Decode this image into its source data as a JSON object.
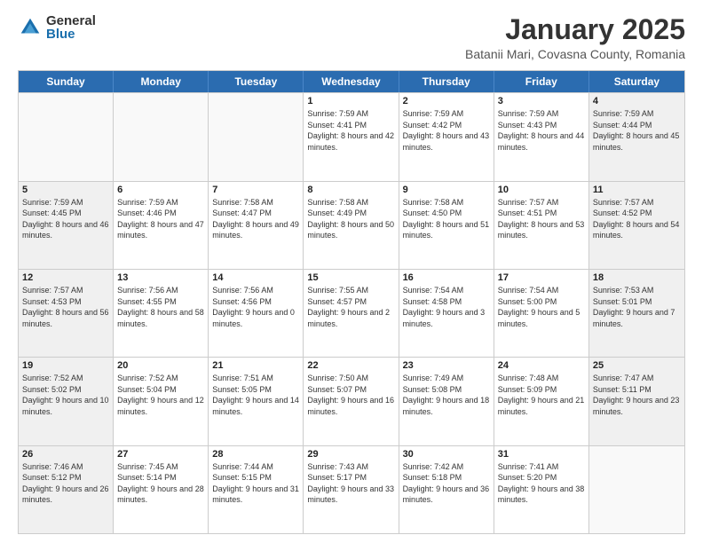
{
  "logo": {
    "general": "General",
    "blue": "Blue"
  },
  "title": "January 2025",
  "subtitle": "Batanii Mari, Covasna County, Romania",
  "days": [
    "Sunday",
    "Monday",
    "Tuesday",
    "Wednesday",
    "Thursday",
    "Friday",
    "Saturday"
  ],
  "weeks": [
    [
      {
        "day": "",
        "info": ""
      },
      {
        "day": "",
        "info": ""
      },
      {
        "day": "",
        "info": ""
      },
      {
        "day": "1",
        "info": "Sunrise: 7:59 AM\nSunset: 4:41 PM\nDaylight: 8 hours and 42 minutes."
      },
      {
        "day": "2",
        "info": "Sunrise: 7:59 AM\nSunset: 4:42 PM\nDaylight: 8 hours and 43 minutes."
      },
      {
        "day": "3",
        "info": "Sunrise: 7:59 AM\nSunset: 4:43 PM\nDaylight: 8 hours and 44 minutes."
      },
      {
        "day": "4",
        "info": "Sunrise: 7:59 AM\nSunset: 4:44 PM\nDaylight: 8 hours and 45 minutes."
      }
    ],
    [
      {
        "day": "5",
        "info": "Sunrise: 7:59 AM\nSunset: 4:45 PM\nDaylight: 8 hours and 46 minutes."
      },
      {
        "day": "6",
        "info": "Sunrise: 7:59 AM\nSunset: 4:46 PM\nDaylight: 8 hours and 47 minutes."
      },
      {
        "day": "7",
        "info": "Sunrise: 7:58 AM\nSunset: 4:47 PM\nDaylight: 8 hours and 49 minutes."
      },
      {
        "day": "8",
        "info": "Sunrise: 7:58 AM\nSunset: 4:49 PM\nDaylight: 8 hours and 50 minutes."
      },
      {
        "day": "9",
        "info": "Sunrise: 7:58 AM\nSunset: 4:50 PM\nDaylight: 8 hours and 51 minutes."
      },
      {
        "day": "10",
        "info": "Sunrise: 7:57 AM\nSunset: 4:51 PM\nDaylight: 8 hours and 53 minutes."
      },
      {
        "day": "11",
        "info": "Sunrise: 7:57 AM\nSunset: 4:52 PM\nDaylight: 8 hours and 54 minutes."
      }
    ],
    [
      {
        "day": "12",
        "info": "Sunrise: 7:57 AM\nSunset: 4:53 PM\nDaylight: 8 hours and 56 minutes."
      },
      {
        "day": "13",
        "info": "Sunrise: 7:56 AM\nSunset: 4:55 PM\nDaylight: 8 hours and 58 minutes."
      },
      {
        "day": "14",
        "info": "Sunrise: 7:56 AM\nSunset: 4:56 PM\nDaylight: 9 hours and 0 minutes."
      },
      {
        "day": "15",
        "info": "Sunrise: 7:55 AM\nSunset: 4:57 PM\nDaylight: 9 hours and 2 minutes."
      },
      {
        "day": "16",
        "info": "Sunrise: 7:54 AM\nSunset: 4:58 PM\nDaylight: 9 hours and 3 minutes."
      },
      {
        "day": "17",
        "info": "Sunrise: 7:54 AM\nSunset: 5:00 PM\nDaylight: 9 hours and 5 minutes."
      },
      {
        "day": "18",
        "info": "Sunrise: 7:53 AM\nSunset: 5:01 PM\nDaylight: 9 hours and 7 minutes."
      }
    ],
    [
      {
        "day": "19",
        "info": "Sunrise: 7:52 AM\nSunset: 5:02 PM\nDaylight: 9 hours and 10 minutes."
      },
      {
        "day": "20",
        "info": "Sunrise: 7:52 AM\nSunset: 5:04 PM\nDaylight: 9 hours and 12 minutes."
      },
      {
        "day": "21",
        "info": "Sunrise: 7:51 AM\nSunset: 5:05 PM\nDaylight: 9 hours and 14 minutes."
      },
      {
        "day": "22",
        "info": "Sunrise: 7:50 AM\nSunset: 5:07 PM\nDaylight: 9 hours and 16 minutes."
      },
      {
        "day": "23",
        "info": "Sunrise: 7:49 AM\nSunset: 5:08 PM\nDaylight: 9 hours and 18 minutes."
      },
      {
        "day": "24",
        "info": "Sunrise: 7:48 AM\nSunset: 5:09 PM\nDaylight: 9 hours and 21 minutes."
      },
      {
        "day": "25",
        "info": "Sunrise: 7:47 AM\nSunset: 5:11 PM\nDaylight: 9 hours and 23 minutes."
      }
    ],
    [
      {
        "day": "26",
        "info": "Sunrise: 7:46 AM\nSunset: 5:12 PM\nDaylight: 9 hours and 26 minutes."
      },
      {
        "day": "27",
        "info": "Sunrise: 7:45 AM\nSunset: 5:14 PM\nDaylight: 9 hours and 28 minutes."
      },
      {
        "day": "28",
        "info": "Sunrise: 7:44 AM\nSunset: 5:15 PM\nDaylight: 9 hours and 31 minutes."
      },
      {
        "day": "29",
        "info": "Sunrise: 7:43 AM\nSunset: 5:17 PM\nDaylight: 9 hours and 33 minutes."
      },
      {
        "day": "30",
        "info": "Sunrise: 7:42 AM\nSunset: 5:18 PM\nDaylight: 9 hours and 36 minutes."
      },
      {
        "day": "31",
        "info": "Sunrise: 7:41 AM\nSunset: 5:20 PM\nDaylight: 9 hours and 38 minutes."
      },
      {
        "day": "",
        "info": ""
      }
    ]
  ]
}
